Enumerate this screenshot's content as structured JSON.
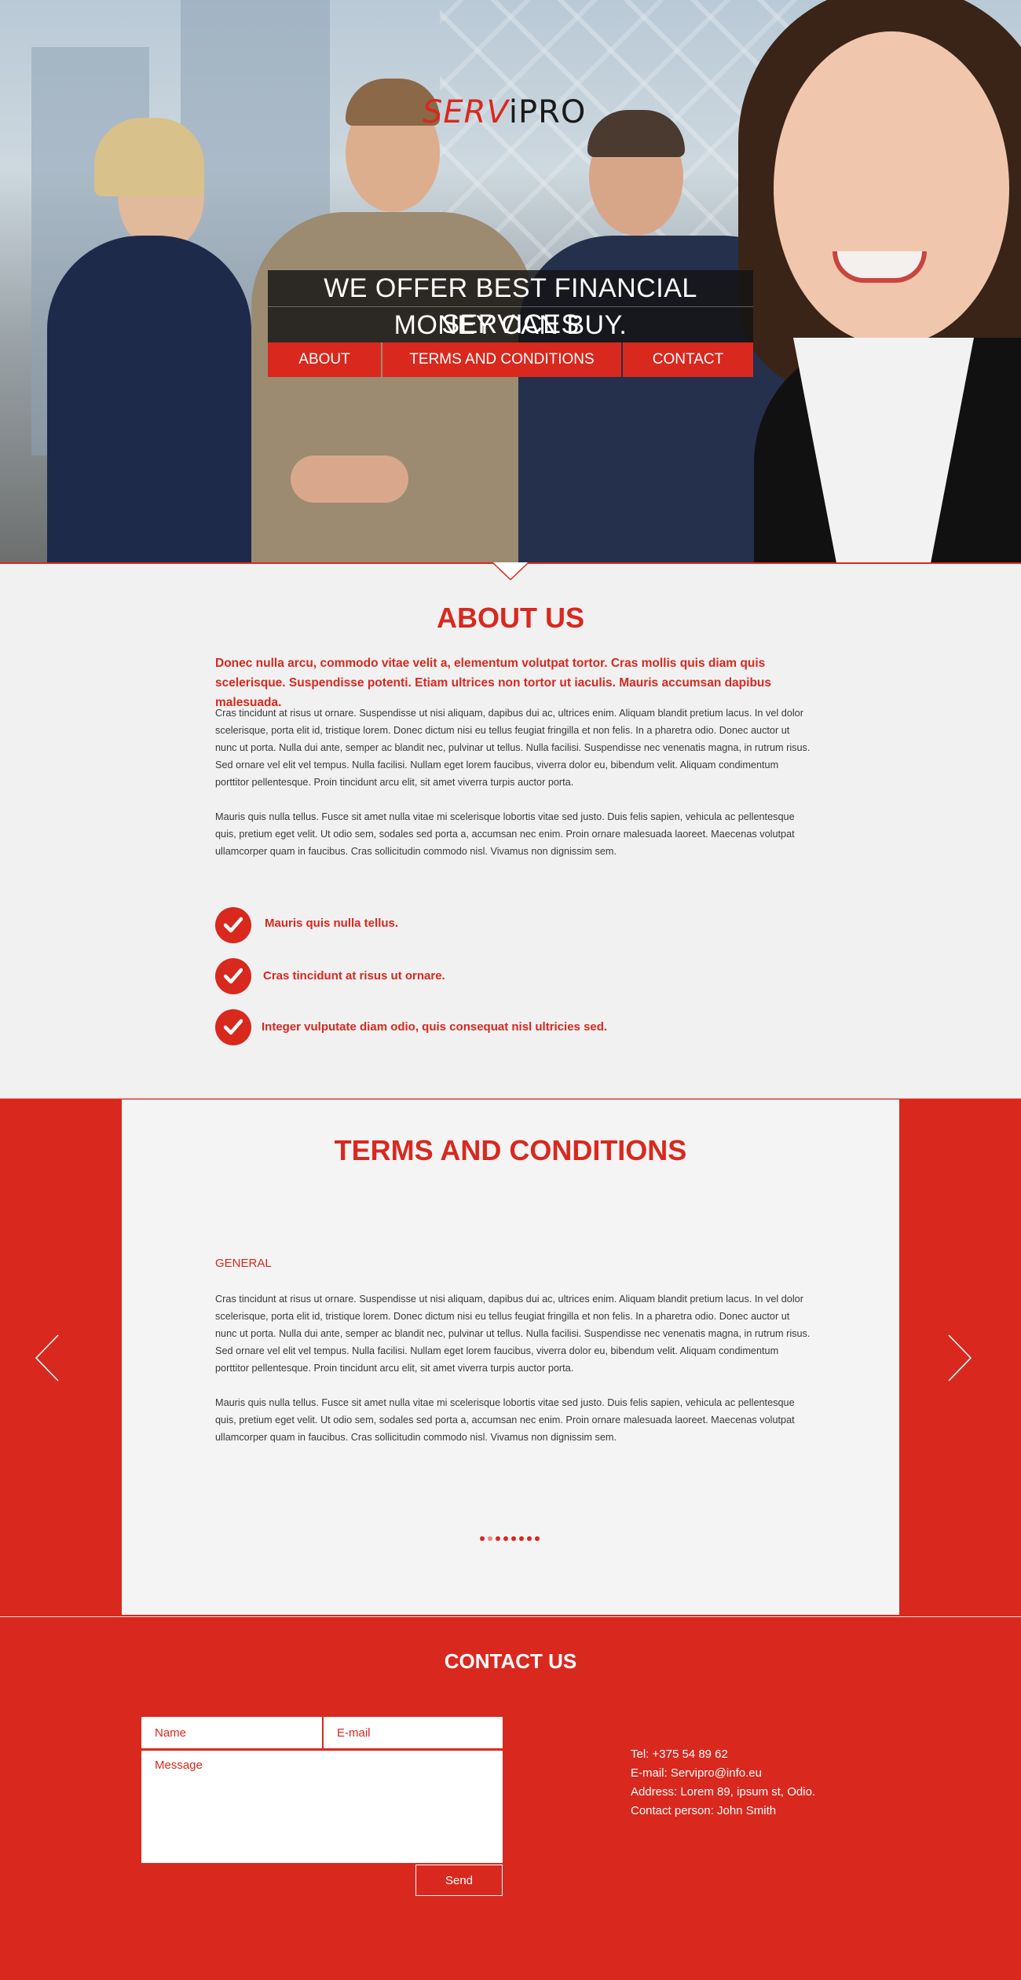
{
  "brand": {
    "logo_part1": "SERV",
    "logo_part2": "iPRO"
  },
  "hero": {
    "tagline_line1": "WE OFFER BEST FINANCIAL SERVICES",
    "tagline_line2": "MONEY CAN BUY."
  },
  "nav": {
    "items": [
      "ABOUT",
      "TERMS AND CONDITIONS",
      "CONTACT"
    ]
  },
  "about": {
    "title": "ABOUT US",
    "lead": "Donec nulla arcu, commodo vitae velit a, elementum volutpat tortor. Cras mollis quis diam quis scelerisque. Suspendisse potenti. Etiam ultrices non tortor ut iaculis. Mauris accumsan dapibus malesuada.",
    "para1": "Cras tincidunt at risus ut ornare. Suspendisse ut nisi aliquam, dapibus dui ac, ultrices enim. Aliquam blandit pretium lacus. In vel dolor scelerisque, porta elit id, tristique lorem. Donec dictum nisi eu tellus feugiat fringilla et non felis. In a pharetra odio. Donec auctor ut nunc ut porta. Nulla dui ante, semper ac blandit nec, pulvinar ut tellus. Nulla facilisi. Suspendisse nec venenatis magna, in rutrum risus. Sed ornare vel elit vel tempus. Nulla facilisi. Nullam eget lorem faucibus, viverra dolor eu, bibendum velit. Aliquam condimentum porttitor pellentesque. Proin tincidunt arcu elit, sit amet viverra turpis auctor porta.",
    "para2": "Mauris quis nulla tellus. Fusce sit amet nulla vitae mi scelerisque lobortis vitae sed justo. Duis felis sapien, vehicula ac pellentesque quis, pretium eget velit. Ut odio sem, sodales sed porta a, accumsan nec enim. Proin ornare malesuada laoreet. Maecenas volutpat ullamcorper quam in faucibus. Cras sollicitudin commodo nisl. Vivamus non dignissim sem.",
    "checks": [
      "Mauris quis nulla tellus.",
      "Cras tincidunt at risus ut ornare.",
      "Integer vulputate diam odio, quis consequat nisl ultricies sed."
    ]
  },
  "terms": {
    "title": "TERMS AND CONDITIONS",
    "subtitle": "GENERAL",
    "para1": "Cras tincidunt at risus ut ornare. Suspendisse ut nisi aliquam, dapibus dui ac, ultrices enim. Aliquam blandit pretium lacus. In vel dolor scelerisque, porta elit id, tristique lorem. Donec dictum nisi eu tellus feugiat fringilla et non felis. In a pharetra odio. Donec auctor ut nunc ut porta. Nulla dui ante, semper ac blandit nec, pulvinar ut tellus. Nulla facilisi. Suspendisse nec venenatis magna, in rutrum risus. Sed ornare vel elit vel tempus. Nulla facilisi. Nullam eget lorem faucibus, viverra dolor eu, bibendum velit. Aliquam condimentum porttitor pellentesque. Proin tincidunt arcu elit, sit amet viverra turpis auctor porta.",
    "para2": "Mauris quis nulla tellus. Fusce sit amet nulla vitae mi scelerisque lobortis vitae sed justo. Duis felis sapien, vehicula ac pellentesque quis, pretium eget velit. Ut odio sem, sodales sed porta a, accumsan nec enim. Proin ornare malesuada laoreet. Maecenas volutpat ullamcorper quam in faucibus. Cras sollicitudin commodo nisl. Vivamus non dignissim sem.",
    "slider": {
      "slide_count": 8,
      "active_index": 1
    }
  },
  "contact": {
    "title": "CONTACT US",
    "name_placeholder": "Name",
    "email_placeholder": "E-mail",
    "message_placeholder": "Message",
    "send_label": "Send",
    "info": {
      "tel": "Tel: +375 54 89 62",
      "email": "E-mail: Servipro@info.eu",
      "address": "Address: Lorem 89, ipsum st, Odio.",
      "person": "Contact person: John Smith"
    }
  },
  "colors": {
    "accent": "#d9281e",
    "light_bg": "#f1f1f1",
    "card_bg": "#f4f4f4",
    "text": "#3a3a3a"
  }
}
